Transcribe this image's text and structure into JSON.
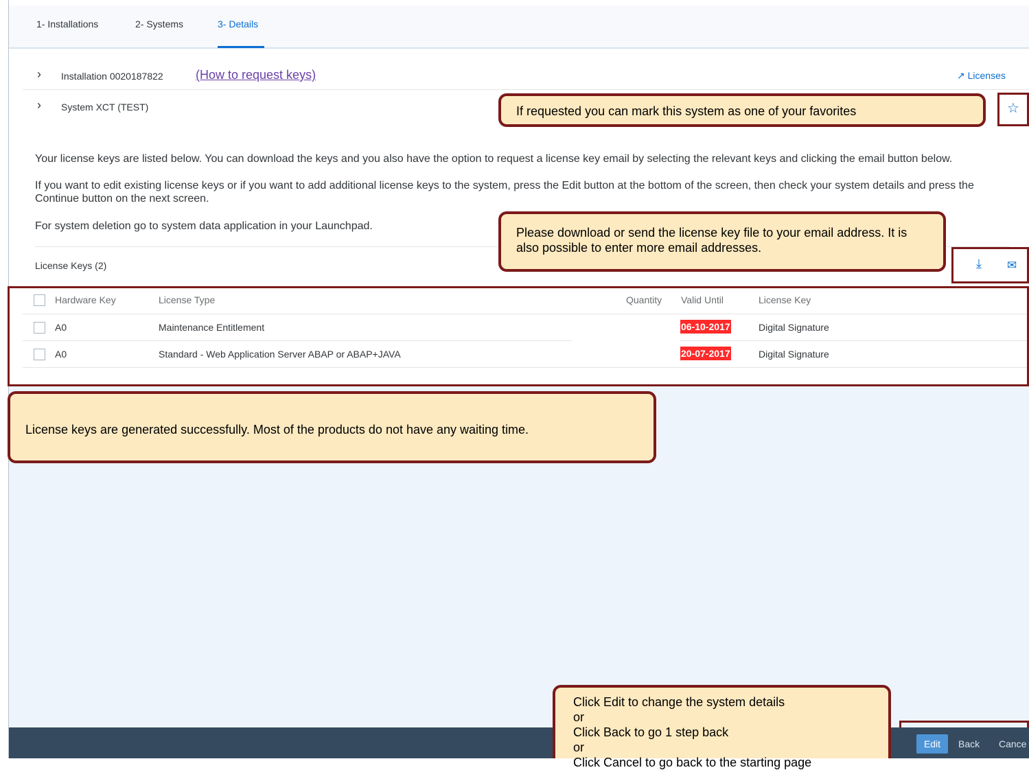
{
  "tabs": [
    "1- Installations",
    "2- Systems",
    "3- Details"
  ],
  "installation": {
    "label": "Installation 0020187822",
    "help_link": "(How to request keys)",
    "licenses_link": "Licenses"
  },
  "system": {
    "label": "System XCT (TEST)"
  },
  "intro": {
    "p1": "Your license keys are listed below. You can download the keys and you also have the option to request a license key email by selecting the relevant keys and clicking the email button below.",
    "p2": "If you want to edit existing license keys or if you want to add additional license keys to the system, press the Edit button at the bottom of the screen, then check your system details and press the Continue button on the next screen.",
    "p3": "For system deletion go to system data application in your Launchpad."
  },
  "license_keys": {
    "title": "License Keys (2)",
    "columns": [
      "Hardware Key",
      "License Type",
      "Quantity",
      "Valid Until",
      "License Key"
    ],
    "rows": [
      {
        "hardware_key": "A0",
        "license_type": "Maintenance Entitlement",
        "quantity": "",
        "valid_until": "06-10-2017",
        "license_key": "Digital Signature"
      },
      {
        "hardware_key": "A0",
        "license_type": "Standard - Web Application Server ABAP or ABAP+JAVA",
        "quantity": "",
        "valid_until": "20-07-2017",
        "license_key": "Digital Signature"
      }
    ]
  },
  "callouts": {
    "favorites": "If requested you can mark this system as one of your favorites",
    "download": "Please download or send the license key file to your email address. It is also possible to enter more email addresses.",
    "generated": "License keys are generated successfully. Most of the products do not have any waiting time.",
    "footer_lines": [
      "Click Edit to change the system details",
      "or",
      "Click Back to go 1 step back",
      "or",
      "Click Cancel to go back to the starting page"
    ]
  },
  "footer": {
    "edit": "Edit",
    "back": "Back",
    "cancel": "Cance"
  },
  "icons": {
    "licenses": "external-link-icon",
    "favorite": "star-icon",
    "download": "download-icon",
    "email": "email-icon",
    "expand": "chevron-right-icon"
  },
  "colors": {
    "accent": "#0a6ed1",
    "expired": "#ff2a2a",
    "callout_bg": "#fdeac1",
    "callout_border": "#7b1a1a",
    "footer": "#354a5f"
  }
}
